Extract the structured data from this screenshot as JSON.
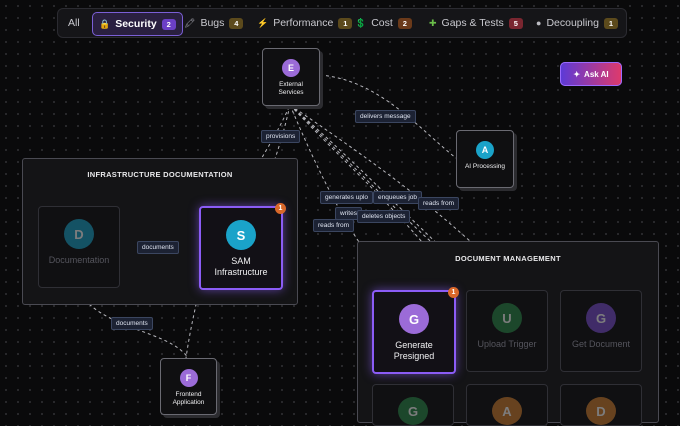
{
  "colors": {
    "accent": "#8b5cf6",
    "issue_badge": "#d9682a"
  },
  "tabs": [
    {
      "label": "All",
      "icon": "",
      "count": null
    },
    {
      "label": "Security",
      "icon": "lock-icon",
      "count": "2",
      "badge_color": "#6b3fc7"
    },
    {
      "label": "Bugs",
      "icon": "bug-icon",
      "count": "4",
      "badge_color": "#5c4a1c"
    },
    {
      "label": "Performance",
      "icon": "bolt-icon",
      "count": "1",
      "badge_color": "#5c4a1c"
    },
    {
      "label": "Cost",
      "icon": "dollar-icon",
      "count": "2",
      "badge_color": "#6b3a1a"
    },
    {
      "label": "Gaps & Tests",
      "icon": "puzzle-icon",
      "count": "5",
      "badge_color": "#7a2630"
    },
    {
      "label": "Decoupling",
      "icon": "circle-icon",
      "count": "1",
      "badge_color": "#5c4a1c"
    }
  ],
  "ask_ai": "Ask AI",
  "groups": {
    "infra": "INFRASTRUCTURE DOCUMENTATION",
    "docmgmt": "DOCUMENT MANAGEMENT"
  },
  "nodes": {
    "external": {
      "letter": "E",
      "label": "External Services",
      "color": "#9b6bd8"
    },
    "ai": {
      "letter": "A",
      "label": "AI Processing",
      "color": "#1aa3c9"
    },
    "documentation": {
      "letter": "D",
      "label": "Documentation",
      "color": "#1aa3c9"
    },
    "sam": {
      "letter": "S",
      "label": "SAM Infrastructure",
      "color": "#1aa3c9",
      "issues": "1"
    },
    "frontend": {
      "letter": "F",
      "label": "Frontend Application",
      "color": "#9b6bd8"
    },
    "generate": {
      "letter": "G",
      "label": "Generate Presigned",
      "color": "#9b6bd8",
      "issues": "1"
    },
    "upload": {
      "letter": "U",
      "label": "Upload Trigger",
      "color": "#2c8a4a"
    },
    "getdoc": {
      "letter": "G",
      "label": "Get Document",
      "color": "#7c4fd0"
    },
    "bottom1": {
      "letter": "G",
      "label": "",
      "color": "#2c8a4a"
    },
    "bottom2": {
      "letter": "A",
      "label": "",
      "color": "#d08030"
    },
    "bottom3": {
      "letter": "D",
      "label": "",
      "color": "#d08030"
    }
  },
  "edges": {
    "delivers": "delivers message",
    "provisions": "provisions",
    "generates": "generates uplo",
    "enqueues": "enqueues job",
    "reads1": "reads from",
    "writes": "writes",
    "deletes": "deletes objects",
    "reads2": "reads from",
    "documents1": "documents",
    "documents2": "documents"
  }
}
